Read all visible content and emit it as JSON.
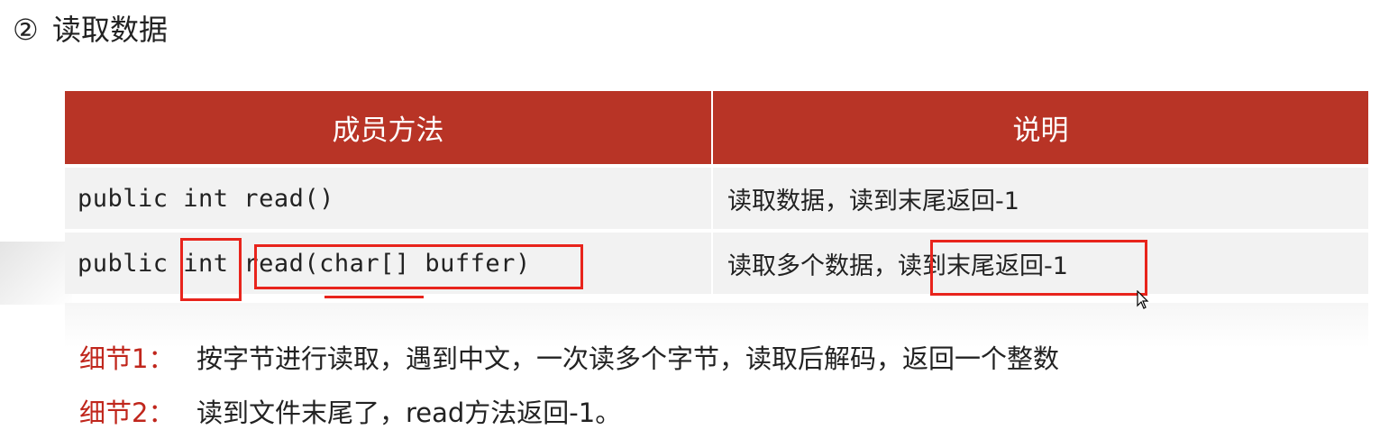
{
  "heading": {
    "number": "②",
    "title": "读取数据"
  },
  "table": {
    "headers": [
      "成员方法",
      "说明"
    ],
    "rows": [
      {
        "method": "public int read()",
        "description": "读取数据，读到末尾返回-1"
      },
      {
        "method_parts": [
          "public ",
          "int",
          " ",
          "read(char[] buffer)"
        ],
        "description_parts": [
          "读取多个数据，",
          "读到末尾返回-1"
        ]
      }
    ]
  },
  "notes": [
    {
      "label": "细节1：",
      "text": "按字节进行读取，遇到中文，一次读多个字节，读取后解码，返回一个整数"
    },
    {
      "label": "细节2：",
      "text": "读到文件末尾了，read方法返回-1。"
    }
  ],
  "colors": {
    "header_bg": "#b83426",
    "annotation": "#e8241c",
    "note_label": "#c0261c"
  }
}
